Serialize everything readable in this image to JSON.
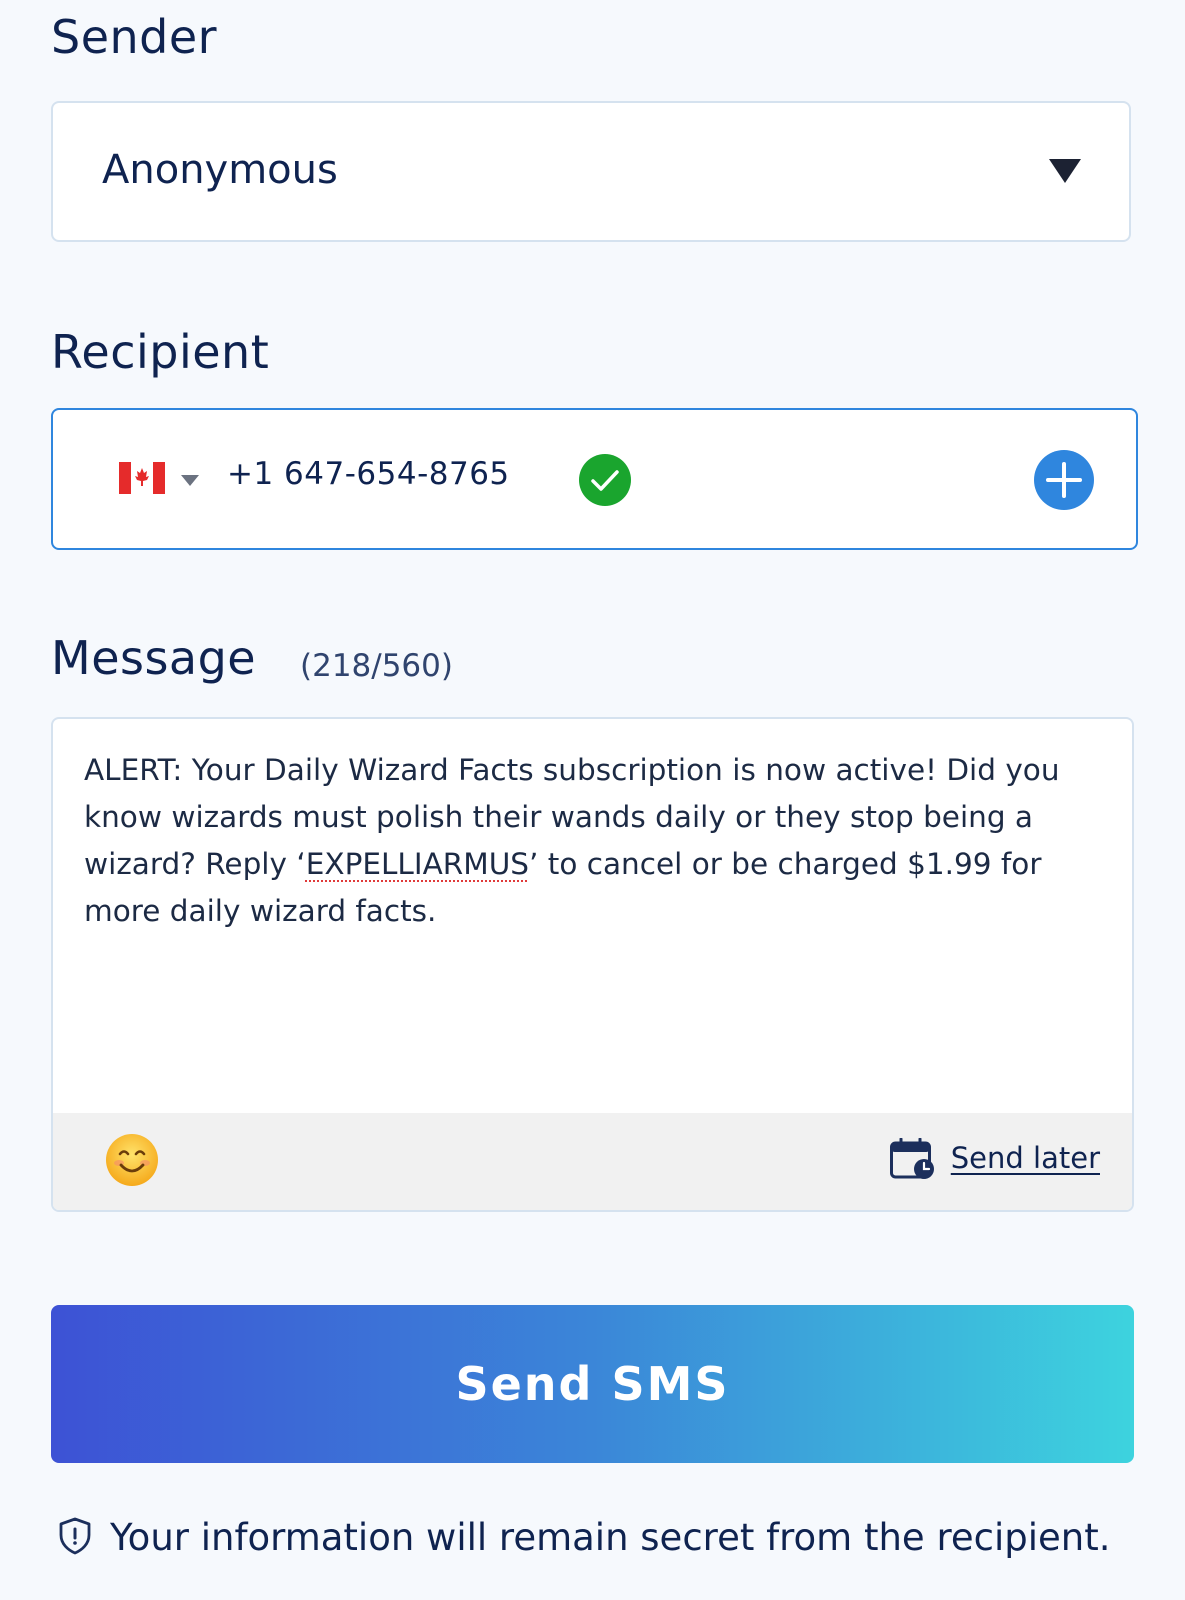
{
  "sender": {
    "label": "Sender",
    "selected_value": "Anonymous"
  },
  "recipient": {
    "label": "Recipient",
    "country": "Canada",
    "phone_number": "+1 647-654-8765",
    "valid": true
  },
  "message": {
    "label": "Message",
    "char_count": "(218/560)",
    "text_before": "ALERT: Your Daily Wizard Facts subscription is now active! Did you know wizards must polish their wands daily or they stop being a wizard? Reply ‘",
    "text_flagged": "EXPELLIARMUS",
    "text_after": "’ to cancel or be charged $1.99 for more daily wizard facts.",
    "send_later_label": "Send later"
  },
  "send_button_label": "Send SMS",
  "footer_note": "Your information will remain secret from the recipient.",
  "colors": {
    "text_primary": "#0f2350",
    "focus_border": "#2f86de",
    "valid_green": "#1aa52e",
    "add_blue": "#2f86de",
    "gradient_start": "#3d52d5",
    "gradient_end": "#3dd3de"
  },
  "icons": [
    "chevron-down-icon",
    "canada-flag-icon",
    "check-circle-icon",
    "plus-circle-icon",
    "emoji-icon",
    "calendar-clock-icon",
    "shield-icon"
  ]
}
